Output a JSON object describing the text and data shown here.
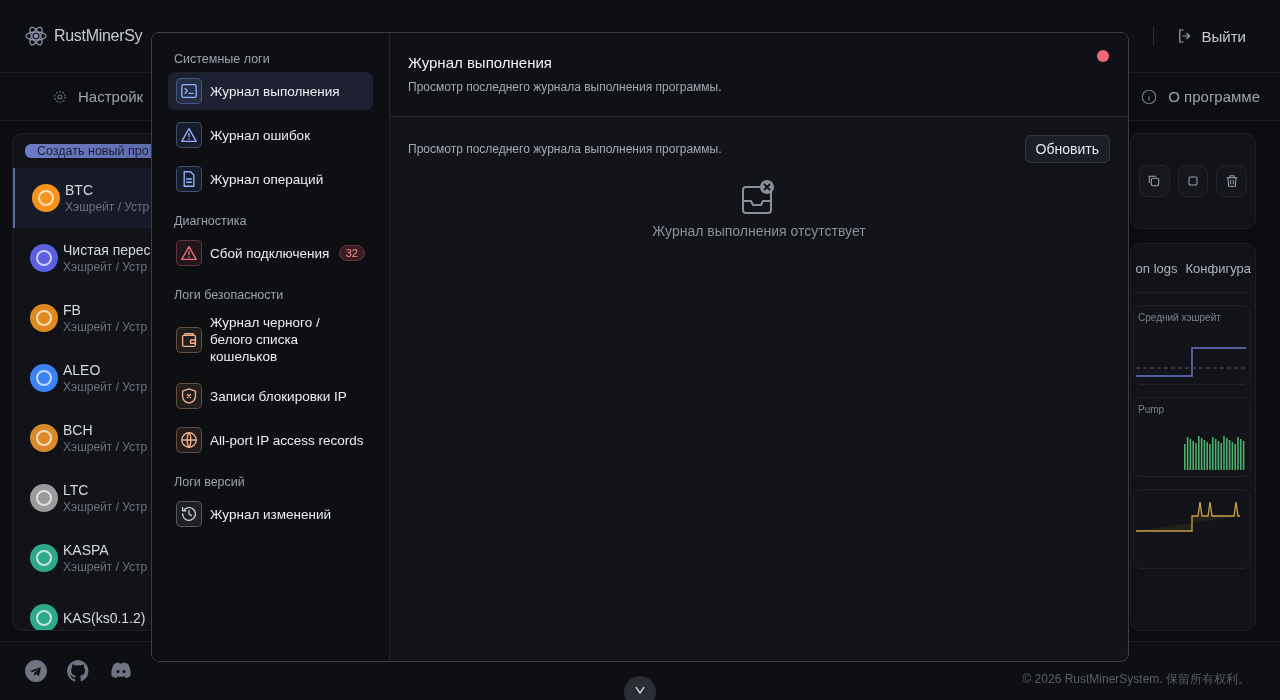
{
  "header": {
    "brand": "RustMinerSy",
    "logout": "Выйти"
  },
  "toolbar": {
    "settings": "Настройк",
    "about": "О программе"
  },
  "pool_panel": {
    "create_button": "Создать новый про",
    "coins": [
      {
        "name": "BTC",
        "subtitle": "Хэшрейт / Устр",
        "color": "#f7931a",
        "selected": true
      },
      {
        "name": "Чистая перес",
        "subtitle": "Хэшрейт / Устр",
        "color": "#5b5fe0",
        "selected": false
      },
      {
        "name": "FB",
        "subtitle": "Хэшрейт / Устр",
        "color": "#e08a1e",
        "selected": false
      },
      {
        "name": "ALEO",
        "subtitle": "Хэшрейт / Устр",
        "color": "#3b82f6",
        "selected": false
      },
      {
        "name": "BCH",
        "subtitle": "Хэшрейт / Устр",
        "color": "#d98b2b",
        "selected": false
      },
      {
        "name": "LTC",
        "subtitle": "Хэшрейт / Устр",
        "color": "#9a9a9a",
        "selected": false
      },
      {
        "name": "KASPA",
        "subtitle": "Хэшрейт / Устр",
        "color": "#2fa88a",
        "selected": false
      },
      {
        "name": "KAS(ks0.1.2)",
        "color": "#2fa88a",
        "selected": false
      }
    ]
  },
  "detail": {
    "tabs": [
      {
        "label": "on logs",
        "selected": false
      },
      {
        "label": "Конфигура",
        "selected": false
      }
    ],
    "charts": [
      {
        "kind": "line",
        "legend": "Средний хэшрейт"
      },
      {
        "kind": "bars",
        "legend": "Pump"
      },
      {
        "kind": "spikes"
      }
    ]
  },
  "footer": {
    "copyright": "© 2026 RustMinerSystem. 保留所有权利。"
  },
  "modal": {
    "sections": [
      {
        "title": "Системные логи",
        "items": [
          {
            "label": "Журнал выполнения",
            "kind": "terminal",
            "color": "#8fb0ff",
            "selected": true
          },
          {
            "label": "Журнал ошибок",
            "kind": "warning",
            "color": "#8fb0ff",
            "selected": false
          },
          {
            "label": "Журнал операций",
            "kind": "document",
            "color": "#8fb0ff",
            "selected": false
          }
        ]
      },
      {
        "title": "Диагностика",
        "items": [
          {
            "label": "Сбой подключения",
            "kind": "warning",
            "color": "#f06b7a",
            "selected": false,
            "badge": "32"
          }
        ]
      },
      {
        "title": "Логи безопасности",
        "items": [
          {
            "label": "Журнал черного / белого списка кошельков",
            "kind": "wallet",
            "color": "#f0b08a",
            "selected": false
          },
          {
            "label": "Записи блокировки IP",
            "kind": "shield",
            "color": "#f0b08a",
            "selected": false
          },
          {
            "label": "All-port IP access records",
            "kind": "globe",
            "color": "#f0b08a",
            "selected": false
          }
        ]
      },
      {
        "title": "Логи версий",
        "items": [
          {
            "label": "Журнал изменений",
            "kind": "history",
            "color": "#c8ccd6",
            "selected": false
          }
        ]
      }
    ],
    "content": {
      "title": "Журнал выполнения",
      "subtitle": "Просмотр последнего журнала выполнения программы.",
      "description": "Просмотр последнего журнала выполнения программы.",
      "refresh_button": "Обновить",
      "empty_text": "Журнал выполнения отсутствует"
    }
  }
}
